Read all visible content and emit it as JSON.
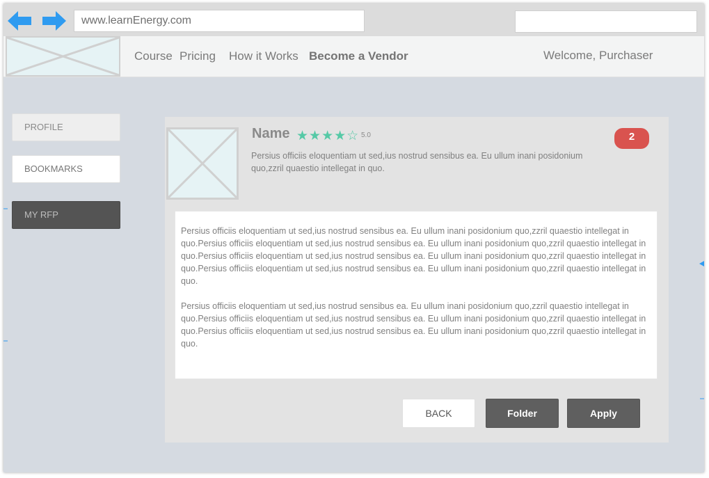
{
  "browser": {
    "url": "www.learnEnergy.com",
    "search_value": "",
    "arrow_color": "#2f9bf0"
  },
  "header": {
    "nav": {
      "course": "Course",
      "pricing": "Pricing",
      "how_it_works": "How it Works",
      "become_vendor": "Become a Vendor"
    },
    "welcome": "Welcome, Purchaser"
  },
  "sidebar": {
    "items": [
      {
        "label": "PROFILE"
      },
      {
        "label": "BOOKMARKS"
      },
      {
        "label": "MY RFP"
      }
    ]
  },
  "card": {
    "name": "Name",
    "stars": "★★★★☆",
    "stars_value": 4,
    "rating": "5.0",
    "summary": "Persius officiis eloquentiam ut sed,ius nostrud sensibus ea. Eu ullum inani posidonium quo,zzril quaestio intellegat in quo.",
    "badge": "2",
    "paragraphs": [
      "Persius officiis eloquentiam ut sed,ius nostrud sensibus ea. Eu ullum inani posidonium quo,zzril quaestio intellegat in quo.Persius officiis eloquentiam ut sed,ius nostrud sensibus ea. Eu ullum inani posidonium quo,zzril quaestio intellegat in quo.Persius officiis eloquentiam ut sed,ius nostrud sensibus ea. Eu ullum inani posidonium quo,zzril quaestio intellegat in quo.Persius officiis eloquentiam ut sed,ius nostrud sensibus ea. Eu ullum inani posidonium quo,zzril quaestio intellegat in quo.",
      "Persius officiis eloquentiam ut sed,ius nostrud sensibus ea. Eu ullum inani posidonium quo,zzril quaestio intellegat in quo.Persius officiis eloquentiam ut sed,ius nostrud sensibus ea. Eu ullum inani posidonium quo,zzril quaestio intellegat in quo.Persius officiis eloquentiam ut sed,ius nostrud sensibus ea. Eu ullum inani posidonium quo,zzril quaestio intellegat in quo."
    ],
    "buttons": {
      "back": "BACK",
      "folder": "Folder",
      "apply": "Apply"
    }
  },
  "colors": {
    "accent_arrows": "#2f9bf0",
    "stars": "#55c9a6",
    "badge": "#d9534f",
    "dark_button": "#5f5f5f"
  }
}
